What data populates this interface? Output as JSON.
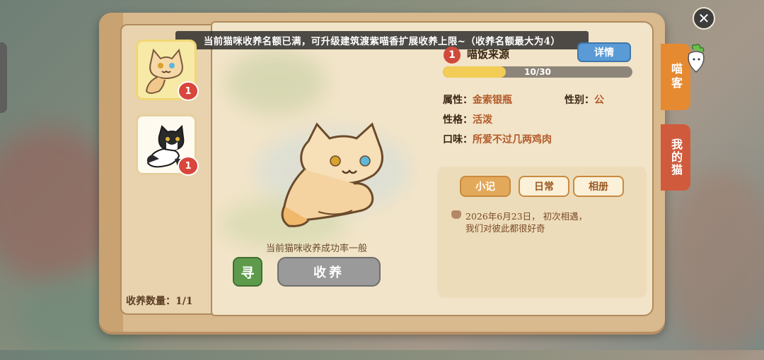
{
  "banner": {
    "message": "当前猫咪收养名额已满，可升级建筑渡紫喵香扩展收养上限~（收养名额最大为4）"
  },
  "cats": [
    {
      "level": "1"
    },
    {
      "level": "1"
    }
  ],
  "adopt_count": {
    "label": "收养数量：1/1"
  },
  "center": {
    "success_rate": "当前猫咪收养成功率一般",
    "seek_label": "寻",
    "adopt_label": "收养"
  },
  "info": {
    "level": "1",
    "name": "喵饭来源",
    "detail_label": "详情",
    "progress": {
      "text": "10/30",
      "fraction": 0.333
    },
    "attribute_key": "属性：",
    "attribute_val": "金索银瓶",
    "gender_key": "性别：",
    "gender_val": "公",
    "personality_key": "性格：",
    "personality_val": "活泼",
    "taste_key": "口味：",
    "taste_val": "所爱不过几两鸡肉"
  },
  "journal": {
    "tabs": [
      "小记",
      "日常",
      "相册"
    ],
    "line1": "2026年6月23日， 初次相遇，",
    "line2": "我们对彼此都很好奇"
  },
  "side_tabs": {
    "guest": "喵客",
    "my_cat": "我的猫"
  },
  "close_label": "✕",
  "colors": {
    "accent_orange": "#e68a32",
    "accent_red": "#cf5b3c",
    "detail_blue": "#5a9bd6",
    "seek_green": "#5e9a4b"
  }
}
